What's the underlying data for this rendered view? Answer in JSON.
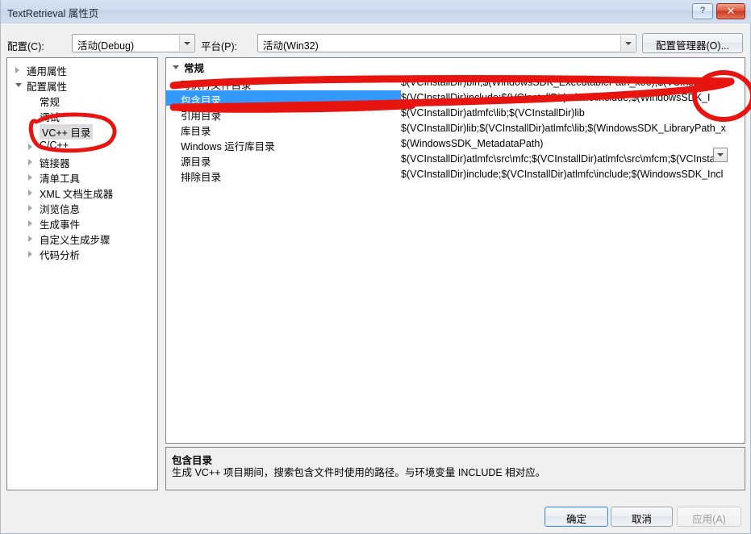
{
  "window": {
    "title": "TextRetrieval 属性页",
    "help_button": "?",
    "close_button": "✕"
  },
  "toolbar": {
    "config_label": "配置(C):",
    "config_value": "活动(Debug)",
    "platform_label": "平台(P):",
    "platform_value": "活动(Win32)",
    "config_manager_button": "配置管理器(O)..."
  },
  "sidebar": {
    "items": [
      {
        "label": "通用属性",
        "level": 0,
        "state": "collapsed",
        "selected": false
      },
      {
        "label": "配置属性",
        "level": 0,
        "state": "expanded",
        "selected": false
      },
      {
        "label": "常规",
        "level": 1,
        "state": "leaf",
        "selected": false
      },
      {
        "label": "调试",
        "level": 1,
        "state": "leaf",
        "selected": false
      },
      {
        "label": "VC++ 目录",
        "level": 1,
        "state": "leaf",
        "selected": true
      },
      {
        "label": "C/C++",
        "level": 1,
        "state": "collapsed",
        "selected": false
      },
      {
        "label": "链接器",
        "level": 1,
        "state": "collapsed",
        "selected": false
      },
      {
        "label": "清单工具",
        "level": 1,
        "state": "collapsed",
        "selected": false
      },
      {
        "label": "XML 文档生成器",
        "level": 1,
        "state": "collapsed",
        "selected": false
      },
      {
        "label": "浏览信息",
        "level": 1,
        "state": "collapsed",
        "selected": false
      },
      {
        "label": "生成事件",
        "level": 1,
        "state": "collapsed",
        "selected": false
      },
      {
        "label": "自定义生成步骤",
        "level": 1,
        "state": "collapsed",
        "selected": false
      },
      {
        "label": "代码分析",
        "level": 1,
        "state": "collapsed",
        "selected": false
      }
    ]
  },
  "grid": {
    "category": "常规",
    "rows": [
      {
        "name": "可执行文件目录",
        "value": "$(VCInstallDir)bin;$(WindowsSDK_ExecutablePath_x86);$(VSInstallDir)C",
        "selected": false
      },
      {
        "name": "包含目录",
        "value": "$(VCInstallDir)include;$(VCInstallDir)atlmfc\\include;$(WindowsSDK_I",
        "selected": true
      },
      {
        "name": "引用目录",
        "value": "$(VCInstallDir)atlmfc\\lib;$(VCInstallDir)lib",
        "selected": false
      },
      {
        "name": "库目录",
        "value": "$(VCInstallDir)lib;$(VCInstallDir)atlmfc\\lib;$(WindowsSDK_LibraryPath_x",
        "selected": false
      },
      {
        "name": "Windows 运行库目录",
        "value": "$(WindowsSDK_MetadataPath)",
        "selected": false
      },
      {
        "name": "源目录",
        "value": "$(VCInstallDir)atlmfc\\src\\mfc;$(VCInstallDir)atlmfc\\src\\mfcm;$(VCInstal",
        "selected": false
      },
      {
        "name": "排除目录",
        "value": "$(VCInstallDir)include;$(VCInstallDir)atlmfc\\include;$(WindowsSDK_Incl",
        "selected": false
      }
    ]
  },
  "description": {
    "title": "包含目录",
    "body": "生成 VC++ 项目期间，搜索包含文件时使用的路径。与环境变量 INCLUDE 相对应。"
  },
  "footer": {
    "ok": "确定",
    "cancel": "取消",
    "apply": "应用(A)"
  },
  "annotations": {
    "color": "#e8140f",
    "marks": [
      "ellipse-around-vcpp-directories-tree-item",
      "scribble-over-include-directories-row",
      "ellipse-around-value-dropdown-button"
    ]
  }
}
